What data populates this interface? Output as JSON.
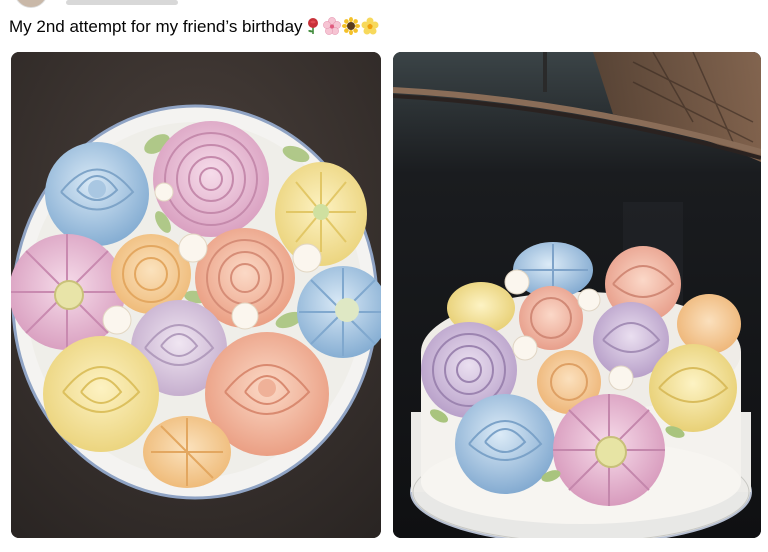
{
  "post": {
    "caption": "My 2nd attempt for my friend’s birthday",
    "caption_emojis": [
      "rose-emoji",
      "cherry-blossom-emoji",
      "sunflower-emoji",
      "blossom-emoji"
    ]
  },
  "photos": [
    {
      "subject": "cake-top-view"
    },
    {
      "subject": "cake-side-view"
    }
  ],
  "colors": {
    "rose_red": "#c8323a",
    "blossom_pink": "#f6c4d3",
    "sunflower_yellow": "#f4c12a",
    "blossom_yellow": "#f7d95c",
    "blue_flower": "#9fc4e0",
    "pink_flower": "#e9b6cf",
    "peach_flower": "#f0b49a",
    "yellow_flower": "#f2df8f",
    "lilac_flower": "#c8b5d6"
  }
}
